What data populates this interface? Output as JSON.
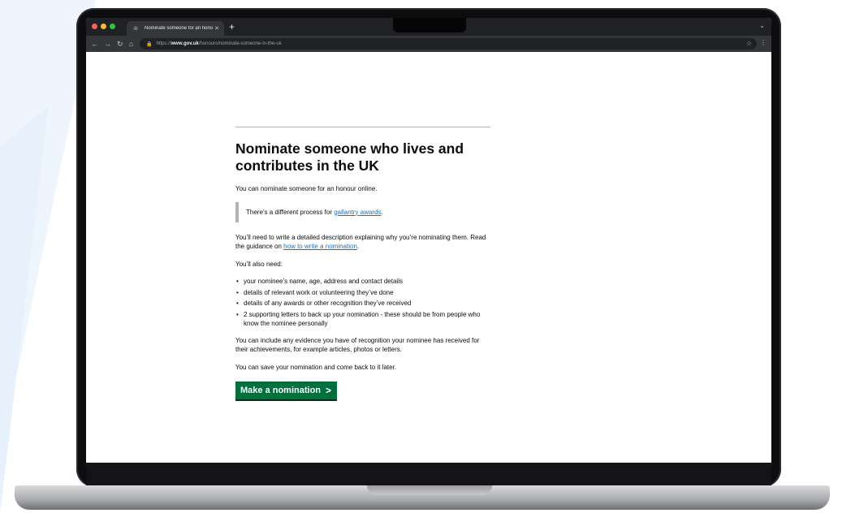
{
  "browser": {
    "tab_title": "Nominate someone for an hono",
    "url_scheme": "https://",
    "url_host": "www.gov.uk",
    "url_path": "/honours/nominate-someone-in-the-uk",
    "traffic_light_colors": [
      "#ff5f57",
      "#febc2e",
      "#28c840"
    ]
  },
  "page": {
    "title": "Nominate someone who lives and contributes in the UK",
    "intro": "You can nominate someone for an honour online.",
    "inset": {
      "prefix": "There’s a different process for ",
      "link_text": "gallantry awards",
      "suffix": "."
    },
    "description": {
      "prefix": "You’ll need to write a detailed description explaining why you’re nominating them. Read the guidance on ",
      "link_text": "how to write a nomination",
      "suffix": "."
    },
    "also_need": "You’ll also need:",
    "requirements": [
      "your nominee’s name, age, address and contact details",
      "details of relevant work or volunteering they’ve done",
      "details of any awards or other recognition they’ve received",
      "2 supporting letters to back up your nomination - these should be from people who know the nominee personally"
    ],
    "evidence": "You can include any evidence you have of recognition your nominee has received for their achievements, for example articles, photos or letters.",
    "save": "You can save your nomination and come back to it later.",
    "start_button": "Make a nomination",
    "colors": {
      "link": "#1d70b8",
      "button": "#00703c",
      "text": "#0b0c0c"
    }
  }
}
